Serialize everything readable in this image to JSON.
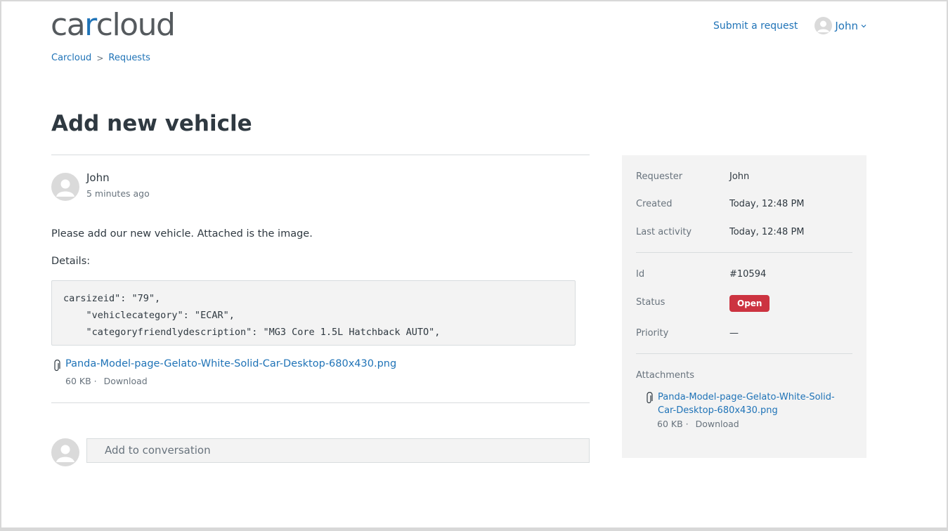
{
  "header": {
    "logo": {
      "part1": "ca",
      "accent": "r",
      "part2": "cloud"
    },
    "submit_request": "Submit a request",
    "user_name": "John"
  },
  "breadcrumb": [
    {
      "label": "Carcloud"
    },
    {
      "label": "Requests"
    }
  ],
  "request": {
    "title": "Add new vehicle",
    "comment": {
      "author": "John",
      "time": "5 minutes ago",
      "body": "Please add our new vehicle. Attached is the image.",
      "details_label": "Details:",
      "code_lines": [
        "carsizeid\": \"79\",",
        "    \"vehiclecategory\": \"ECAR\",",
        "    \"categoryfriendlydescription\": \"MG3 Core 1.5L Hatchback AUTO\","
      ],
      "attachment": {
        "name": "Panda-Model-page-Gelato-White-Solid-Car-Desktop-680x430.png",
        "size": "60 KB",
        "separator": "·",
        "download": "Download"
      }
    },
    "reply_placeholder": "Add to conversation"
  },
  "sidebar": {
    "requester": {
      "label": "Requester",
      "value": "John"
    },
    "created": {
      "label": "Created",
      "value": "Today, 12:48 PM"
    },
    "last_activity": {
      "label": "Last activity",
      "value": "Today, 12:48 PM"
    },
    "id": {
      "label": "Id",
      "value": "#10594"
    },
    "status": {
      "label": "Status",
      "value": "Open"
    },
    "priority": {
      "label": "Priority",
      "value": "—"
    },
    "attachments": {
      "label": "Attachments",
      "name": "Panda-Model-page-Gelato-White-Solid-Car-Desktop-680x430.png",
      "size": "60 KB",
      "separator": "·",
      "download": "Download"
    }
  },
  "colors": {
    "link": "#1f73b7",
    "status_open": "#cc3340",
    "sidebar_bg": "#f3f3f3"
  }
}
